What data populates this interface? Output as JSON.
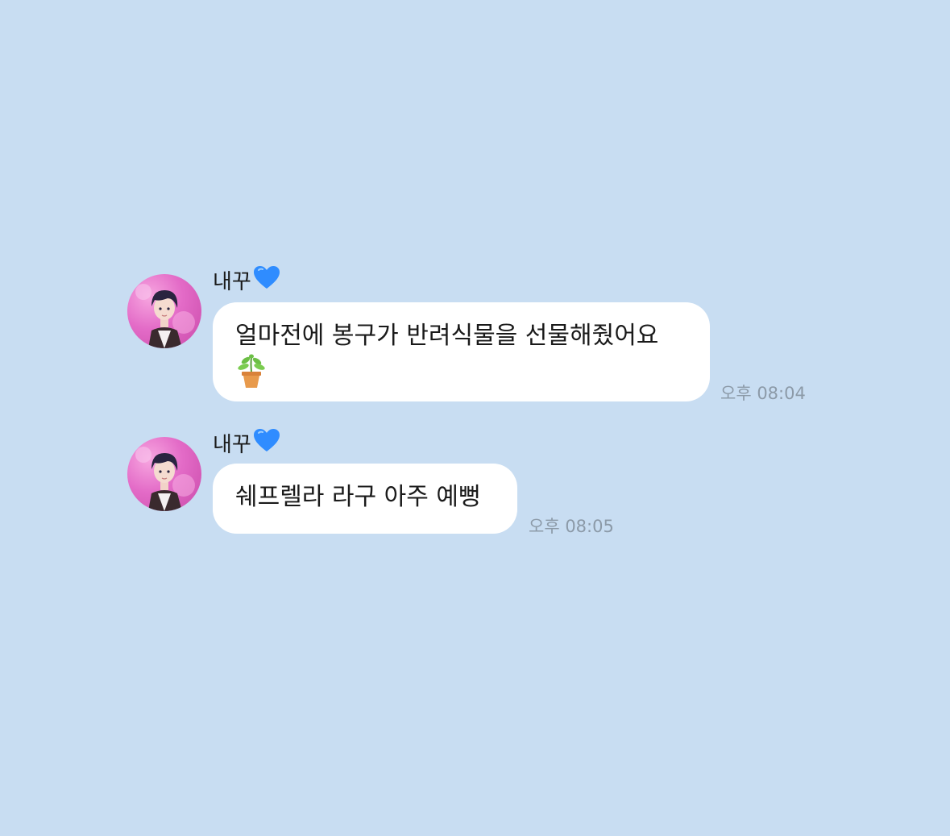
{
  "chat": {
    "messages": [
      {
        "sender": "내꾸",
        "sender_emoji": "blue-heart-icon",
        "text": "얼마전에 봉구가 반려식물을 선물해줬어요",
        "emoji": "potted-plant-icon",
        "time": "오후 08:04"
      },
      {
        "sender": "내꾸",
        "sender_emoji": "blue-heart-icon",
        "text": "쉐프렐라 라구 아주 예뻥",
        "time": "오후 08:05"
      }
    ]
  },
  "colors": {
    "background": "#c8ddf2",
    "bubble": "#ffffff",
    "timestamp": "#8c9aa8",
    "heart": "#2f8cff"
  }
}
